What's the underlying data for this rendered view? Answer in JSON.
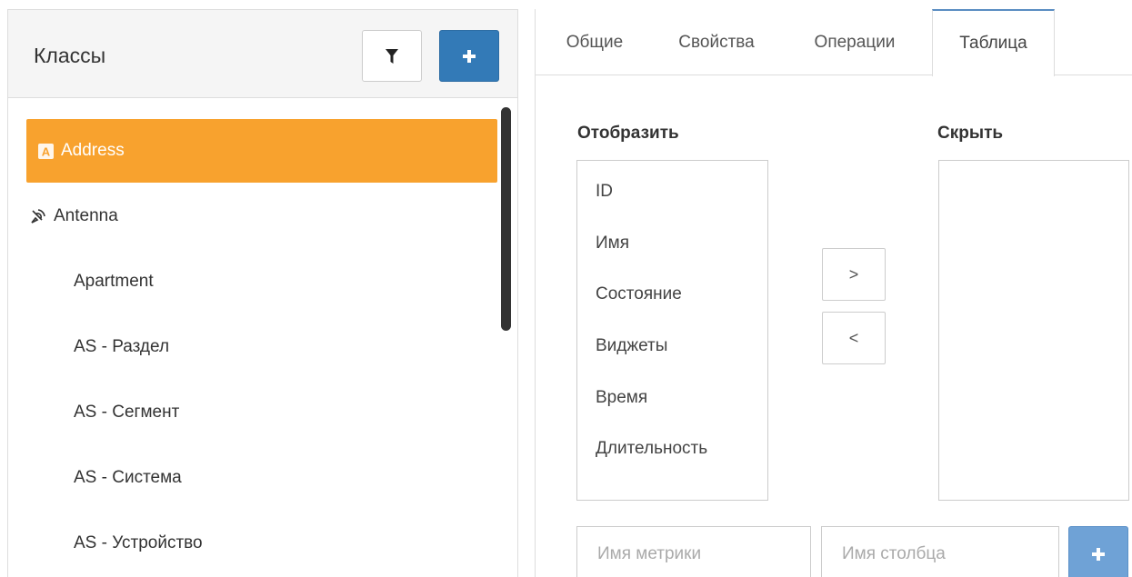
{
  "left_panel": {
    "title": "Классы",
    "filter_icon": "filter-icon",
    "add_icon": "plus-icon",
    "classes": [
      {
        "label": "Address",
        "icon": "letter-a-icon",
        "active": true
      },
      {
        "label": "Antenna",
        "icon": "satellite-icon",
        "active": false
      },
      {
        "label": "Apartment",
        "icon": "",
        "active": false
      },
      {
        "label": "AS - Раздел",
        "icon": "",
        "active": false
      },
      {
        "label": "AS - Сегмент",
        "icon": "",
        "active": false
      },
      {
        "label": "AS - Система",
        "icon": "",
        "active": false
      },
      {
        "label": "AS - Устройство",
        "icon": "",
        "active": false
      }
    ]
  },
  "tabs": [
    {
      "label": "Общие",
      "active": false
    },
    {
      "label": "Свойства",
      "active": false
    },
    {
      "label": "Операции",
      "active": false
    },
    {
      "label": "Таблица",
      "active": true
    }
  ],
  "table_settings": {
    "show_heading": "Отобразить",
    "hide_heading": "Скрыть",
    "shown_columns": [
      "ID",
      "Имя",
      "Состояние",
      "Виджеты",
      "Время",
      "Длительность"
    ],
    "hidden_columns": [],
    "move_right_label": ">",
    "move_left_label": "<",
    "metric_placeholder": "Имя метрики",
    "column_placeholder": "Имя столбца"
  },
  "colors": {
    "active_item": "#f8a22e",
    "primary_button": "#337ab7",
    "tab_accent": "#5a8dc2"
  }
}
